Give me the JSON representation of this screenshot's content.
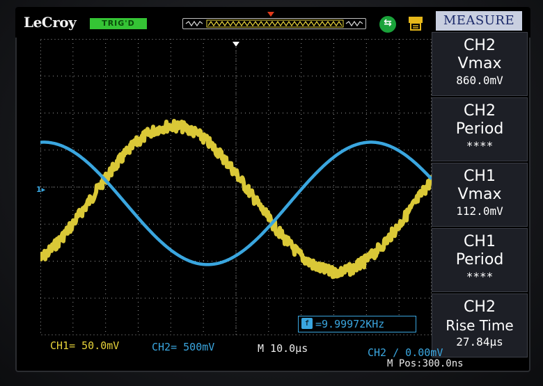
{
  "header": {
    "brand": "LeCroy",
    "run_status": "TRIG'D",
    "usb_icon": "usb-icon",
    "printer_icon": "printer-icon"
  },
  "measure": {
    "title": "MEASURE",
    "items": [
      {
        "channel": "CH2",
        "param": "Vmax",
        "value": "860.0mV"
      },
      {
        "channel": "CH2",
        "param": "Period",
        "value": "****"
      },
      {
        "channel": "CH1",
        "param": "Vmax",
        "value": "112.0mV"
      },
      {
        "channel": "CH1",
        "param": "Period",
        "value": "****"
      },
      {
        "channel": "CH2",
        "param": "Rise Time",
        "value": "27.84µs"
      }
    ]
  },
  "readout": {
    "frequency": "=9.99972KHz"
  },
  "status": {
    "ch1_scale": "CH1= 50.0mV",
    "ch2_scale": "CH2= 500mV",
    "timebase": "M 10.0µs",
    "trigger": "CH2 ∕ 0.00mV",
    "mpos": "M Pos:300.0ns"
  },
  "colors": {
    "ch1": "#e6d33a",
    "ch2": "#3aa6df",
    "grid": "#9a9a9a",
    "measure_title_bg": "#c9cfe0"
  }
}
